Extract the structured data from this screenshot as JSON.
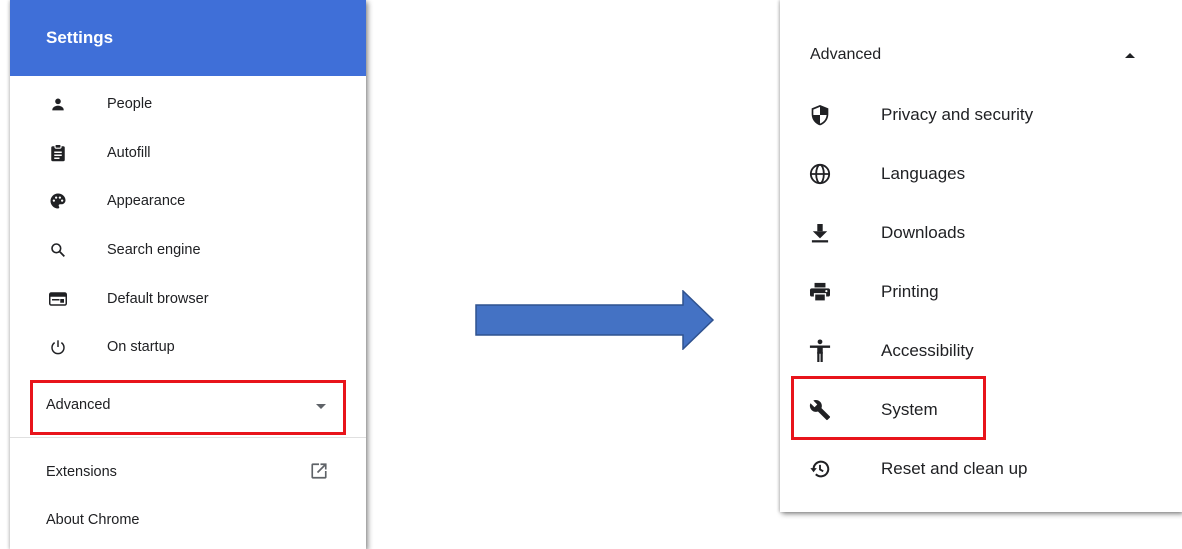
{
  "left_panel": {
    "title": "Settings",
    "nav_items": [
      {
        "label": "People",
        "icon": "person-icon"
      },
      {
        "label": "Autofill",
        "icon": "clipboard-icon"
      },
      {
        "label": "Appearance",
        "icon": "palette-icon"
      },
      {
        "label": "Search engine",
        "icon": "search-icon"
      },
      {
        "label": "Default browser",
        "icon": "browser-window-icon"
      },
      {
        "label": "On startup",
        "icon": "power-icon"
      }
    ],
    "advanced_label": "Advanced",
    "advanced_state": "collapsed",
    "extensions_label": "Extensions",
    "extensions_icon": "open-in-new-icon",
    "about_label": "About Chrome"
  },
  "right_panel": {
    "advanced_label": "Advanced",
    "advanced_state": "expanded",
    "items": [
      {
        "label": "Privacy and security",
        "icon": "shield-icon"
      },
      {
        "label": "Languages",
        "icon": "globe-icon"
      },
      {
        "label": "Downloads",
        "icon": "download-icon"
      },
      {
        "label": "Printing",
        "icon": "printer-icon"
      },
      {
        "label": "Accessibility",
        "icon": "accessibility-icon"
      },
      {
        "label": "System",
        "icon": "wrench-icon"
      },
      {
        "label": "Reset and clean up",
        "icon": "restore-icon"
      }
    ]
  },
  "colors": {
    "header_blue": "#3f6fd8",
    "arrow_blue": "#4472c4",
    "highlight_red": "#e8141b",
    "text": "#202124",
    "icon": "#202124"
  }
}
